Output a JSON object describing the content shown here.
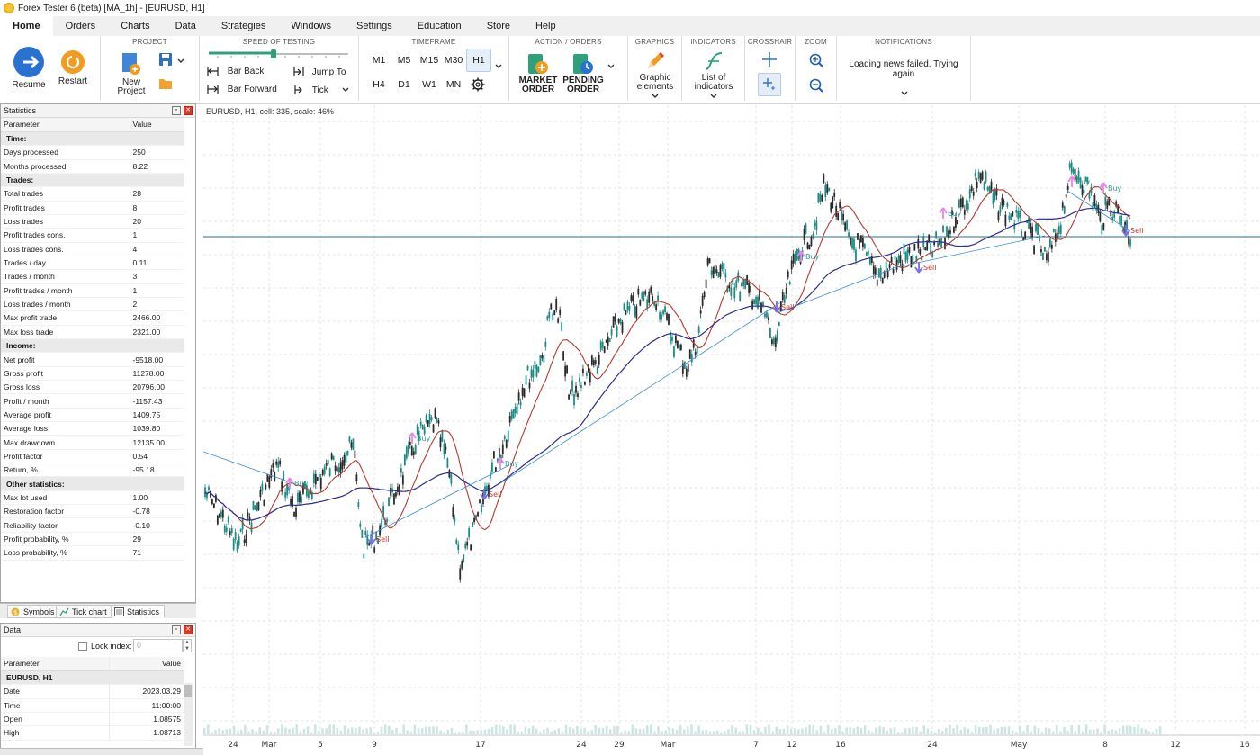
{
  "window": {
    "title": "Forex Tester 6 (beta)  [MA_1h] - [EURUSD, H1]"
  },
  "menu": [
    {
      "label": "Home",
      "active": true
    },
    {
      "label": "Orders"
    },
    {
      "label": "Charts"
    },
    {
      "label": "Data"
    },
    {
      "label": "Strategies"
    },
    {
      "label": "Windows"
    },
    {
      "label": "Settings"
    },
    {
      "label": "Education"
    },
    {
      "label": "Store"
    },
    {
      "label": "Help"
    }
  ],
  "ribbon": {
    "resume": "Resume",
    "restart": "Restart",
    "project_title": "PROJECT",
    "new_project_1": "New",
    "new_project_2": "Project",
    "speed_title": "SPEED OF TESTING",
    "bar_back": "Bar Back",
    "bar_forward": "Bar Forward",
    "jump_to": "Jump To",
    "tick": "Tick",
    "timeframe_title": "TIMEFRAME",
    "timeframes_row1": [
      "M1",
      "M5",
      "M15",
      "M30",
      "H1"
    ],
    "timeframes_row2": [
      "H4",
      "D1",
      "W1",
      "MN"
    ],
    "selected_timeframe": "H1",
    "action_title": "ACTION / ORDERS",
    "market_1": "MARKET",
    "market_2": "ORDER",
    "pending_1": "PENDING",
    "pending_2": "ORDER",
    "graphics_title": "GRAPHICS",
    "graphic_1": "Graphic",
    "graphic_2": "elements",
    "indicators_title": "INDICATORS",
    "indicators_1": "List of",
    "indicators_2": "indicators",
    "crosshair_title": "CROSSHAIR",
    "zoom_title": "ZOOM",
    "notifications_title": "NOTIFICATIONS",
    "notif_1": "Loading news failed. Trying",
    "notif_2": "again"
  },
  "statistics": {
    "title": "Statistics",
    "col_param": "Parameter",
    "col_value": "Value",
    "rows": [
      {
        "section": "Time:"
      },
      {
        "p": "Days processed",
        "v": "250"
      },
      {
        "p": "Months processed",
        "v": "8.22"
      },
      {
        "section": "Trades:"
      },
      {
        "p": "Total trades",
        "v": "28"
      },
      {
        "p": "Profit trades",
        "v": "8"
      },
      {
        "p": "Loss trades",
        "v": "20"
      },
      {
        "p": "Profit trades cons.",
        "v": "1"
      },
      {
        "p": "Loss trades cons.",
        "v": "4"
      },
      {
        "p": "Trades / day",
        "v": "0.11"
      },
      {
        "p": "Trades / month",
        "v": "3"
      },
      {
        "p": "Profit trades / month",
        "v": "1"
      },
      {
        "p": "Loss trades / month",
        "v": "2"
      },
      {
        "p": "Max profit trade",
        "v": "2466.00"
      },
      {
        "p": "Max loss trade",
        "v": "2321.00"
      },
      {
        "section": "Income:"
      },
      {
        "p": "Net profit",
        "v": "-9518.00"
      },
      {
        "p": "Gross profit",
        "v": "11278.00"
      },
      {
        "p": "Gross loss",
        "v": "20796.00"
      },
      {
        "p": "Profit / month",
        "v": "-1157.43"
      },
      {
        "p": "Average profit",
        "v": "1409.75"
      },
      {
        "p": "Average loss",
        "v": "1039.80"
      },
      {
        "p": "Max drawdown",
        "v": "12135.00"
      },
      {
        "p": "Profit factor",
        "v": "0.54"
      },
      {
        "p": "Return, %",
        "v": "-95.18"
      },
      {
        "section": "Other statistics:"
      },
      {
        "p": "Max lot used",
        "v": "1.00"
      },
      {
        "p": "Restoration factor",
        "v": "-0.78"
      },
      {
        "p": "Reliability factor",
        "v": "-0.10"
      },
      {
        "p": "Profit probability, %",
        "v": "29"
      },
      {
        "p": "Loss probability, %",
        "v": "71"
      }
    ],
    "tabs": [
      "Symbols",
      "Tick chart",
      "Statistics"
    ]
  },
  "data_panel": {
    "title": "Data",
    "lock_label": "Lock index:",
    "lock_value": "0",
    "col_param": "Parameter",
    "col_value": "Value",
    "symbol": "EURUSD, H1",
    "rows": [
      {
        "p": "Date",
        "v": "2023.03.29"
      },
      {
        "p": "Time",
        "v": "11:00:00"
      },
      {
        "p": "Open",
        "v": "1.08575"
      },
      {
        "p": "High",
        "v": "1.08713"
      }
    ]
  },
  "chart": {
    "caption": "EURUSD, H1, cell: 335, scale: 46%",
    "x_labels": [
      "24",
      "Mar",
      "5",
      "9",
      "17",
      "24",
      "29",
      "Mar",
      "7",
      "12",
      "16",
      "24",
      "May",
      "8",
      "12",
      "16"
    ],
    "trade_labels": [
      {
        "text": "Buy",
        "type": "buy"
      },
      {
        "text": "Buy",
        "type": "buy"
      },
      {
        "text": "Buy",
        "type": "buy"
      },
      {
        "text": "Buy",
        "type": "buy"
      },
      {
        "text": "Buy",
        "type": "buy"
      },
      {
        "text": "Buy",
        "type": "buy"
      },
      {
        "text": "Buy",
        "type": "buy"
      },
      {
        "text": "Sell",
        "type": "sell"
      },
      {
        "text": "Sell",
        "type": "sell"
      },
      {
        "text": "Sell",
        "type": "sell"
      },
      {
        "text": "Sell",
        "type": "sell"
      },
      {
        "text": "Sell",
        "type": "sell"
      }
    ],
    "colors": {
      "up": "#1d8a84",
      "down": "#2b2b2b",
      "ma_fast": "#b23a2e",
      "ma_slow": "#2a2e8a",
      "trade_line": "#3a8fd0",
      "buy": "#e389e8",
      "sell": "#7a6fe0",
      "grid": "#e6e6e6",
      "hline": "#2e6b86"
    }
  }
}
